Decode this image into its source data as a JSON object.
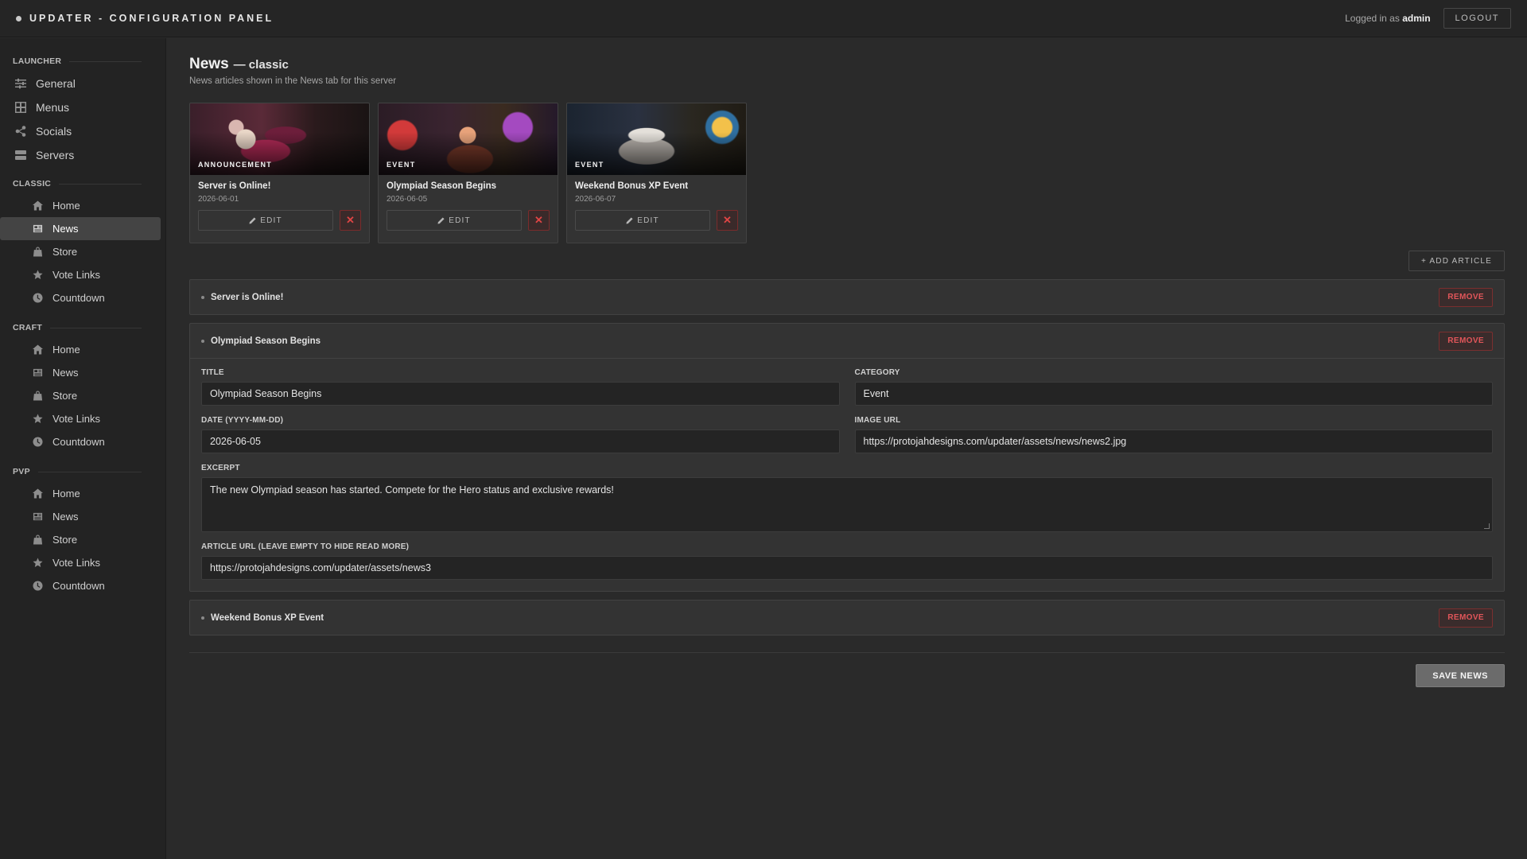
{
  "app": {
    "title": "UPDATER - CONFIGURATION PANEL",
    "logged_prefix": "Logged in as",
    "username": "admin",
    "logout_label": "LOGOUT"
  },
  "sidebar": {
    "launcher": {
      "label": "LAUNCHER",
      "items": [
        {
          "label": "General",
          "icon": "sliders-icon"
        },
        {
          "label": "Menus",
          "icon": "grid-icon"
        },
        {
          "label": "Socials",
          "icon": "share-icon"
        },
        {
          "label": "Servers",
          "icon": "server-icon"
        }
      ]
    },
    "classic": {
      "label": "CLASSIC",
      "items": [
        {
          "label": "Home",
          "icon": "home-icon"
        },
        {
          "label": "News",
          "icon": "newspaper-icon",
          "active": true
        },
        {
          "label": "Store",
          "icon": "bag-icon"
        },
        {
          "label": "Vote Links",
          "icon": "star-icon"
        },
        {
          "label": "Countdown",
          "icon": "clock-icon"
        }
      ]
    },
    "craft": {
      "label": "CRAFT",
      "items": [
        {
          "label": "Home",
          "icon": "home-icon"
        },
        {
          "label": "News",
          "icon": "newspaper-icon"
        },
        {
          "label": "Store",
          "icon": "bag-icon"
        },
        {
          "label": "Vote Links",
          "icon": "star-icon"
        },
        {
          "label": "Countdown",
          "icon": "clock-icon"
        }
      ]
    },
    "pvp": {
      "label": "PVP",
      "items": [
        {
          "label": "Home",
          "icon": "home-icon"
        },
        {
          "label": "News",
          "icon": "newspaper-icon"
        },
        {
          "label": "Store",
          "icon": "bag-icon"
        },
        {
          "label": "Vote Links",
          "icon": "star-icon"
        },
        {
          "label": "Countdown",
          "icon": "clock-icon"
        }
      ]
    }
  },
  "page": {
    "title": "News",
    "subtitle": "— classic",
    "description": "News articles shown in the News tab for this server"
  },
  "cards": [
    {
      "badge": "ANNOUNCEMENT",
      "title": "Server is Online!",
      "date": "2026-06-01",
      "edit_label": "EDIT",
      "delete_label": "✕"
    },
    {
      "badge": "EVENT",
      "title": "Olympiad Season Begins",
      "date": "2026-06-05",
      "edit_label": "EDIT",
      "delete_label": "✕"
    },
    {
      "badge": "EVENT",
      "title": "Weekend Bonus XP Event",
      "date": "2026-06-07",
      "edit_label": "EDIT",
      "delete_label": "✕"
    }
  ],
  "add_article_label": "+ ADD ARTICLE",
  "remove_label": "REMOVE",
  "articles": [
    {
      "title": "Server is Online!"
    },
    {
      "title": "Olympiad Season Begins",
      "fields": {
        "title_label": "TITLE",
        "title_value": "Olympiad Season Begins",
        "category_label": "CATEGORY",
        "category_value": "Event",
        "date_label": "DATE (YYYY-MM-DD)",
        "date_value": "2026-06-05",
        "image_label": "IMAGE URL",
        "image_value": "https://protojahdesigns.com/updater/assets/news/news2.jpg",
        "excerpt_label": "EXCERPT",
        "excerpt_value": "The new Olympiad season has started. Compete for the Hero status and exclusive rewards!",
        "url_label": "ARTICLE URL (LEAVE EMPTY TO HIDE READ MORE)",
        "url_value": "https://protojahdesigns.com/updater/assets/news3"
      }
    },
    {
      "title": "Weekend Bonus XP Event"
    }
  ],
  "save_label": "SAVE NEWS"
}
